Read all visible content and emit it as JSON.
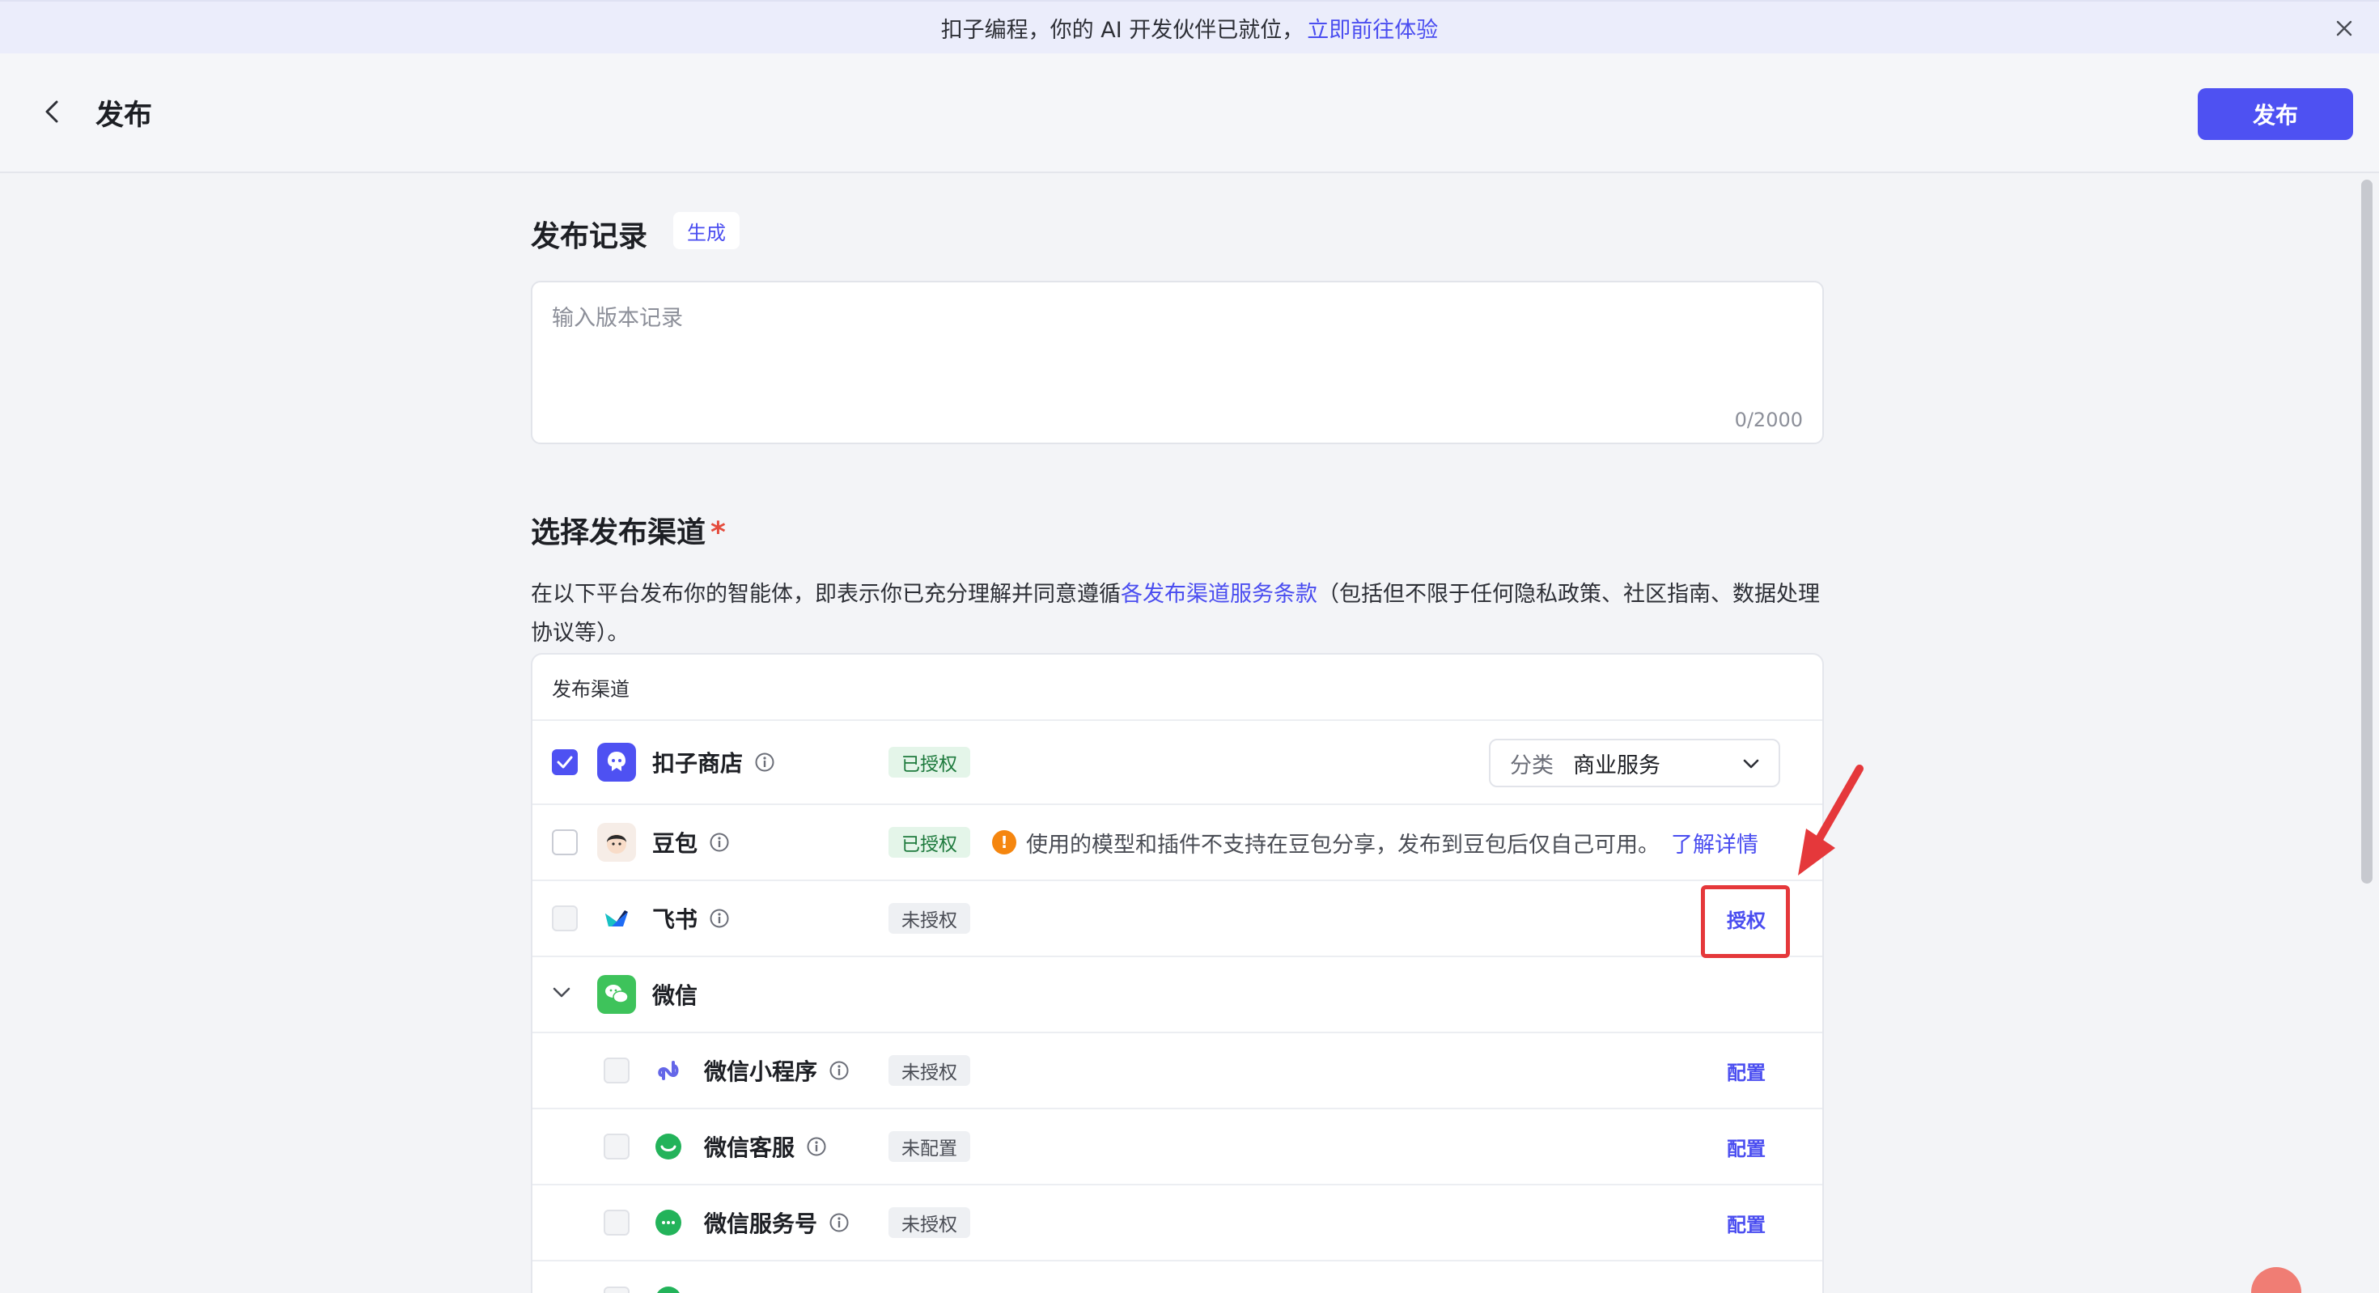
{
  "banner": {
    "text": "扣子编程，你的 AI 开发伙伴已就位，",
    "link": "立即前往体验"
  },
  "header": {
    "title": "发布",
    "publish_label": "发布"
  },
  "record": {
    "title": "发布记录",
    "generate_label": "生成",
    "placeholder": "输入版本记录",
    "counter": "0/2000"
  },
  "channels": {
    "title": "选择发布渠道",
    "required_mark": "*",
    "desc_before": "在以下平台发布你的智能体，即表示你已充分理解并同意遵循",
    "desc_link": "各发布渠道服务条款",
    "desc_after": "（包括但不限于任何隐私政策、社区指南、数据处理协议等）。",
    "table_header": "发布渠道",
    "rows": [
      {
        "name": "扣子商店",
        "status": "已授权",
        "category_label": "分类",
        "category_value": "商业服务"
      },
      {
        "name": "豆包",
        "status": "已授权",
        "warning": "使用的模型和插件不支持在豆包分享，发布到豆包后仅自己可用。",
        "warning_link": "了解详情"
      },
      {
        "name": "飞书",
        "status": "未授权",
        "action": "授权"
      },
      {
        "name": "微信"
      },
      {
        "name": "微信小程序",
        "status": "未授权",
        "action": "配置"
      },
      {
        "name": "微信客服",
        "status": "未配置",
        "action": "配置"
      },
      {
        "name": "微信服务号",
        "status": "未授权",
        "action": "配置"
      }
    ]
  },
  "colors": {
    "accent": "#4e51f2",
    "authorized_bg": "#e4f5e9",
    "warning": "#f5860f",
    "highlight": "#e5383b"
  }
}
